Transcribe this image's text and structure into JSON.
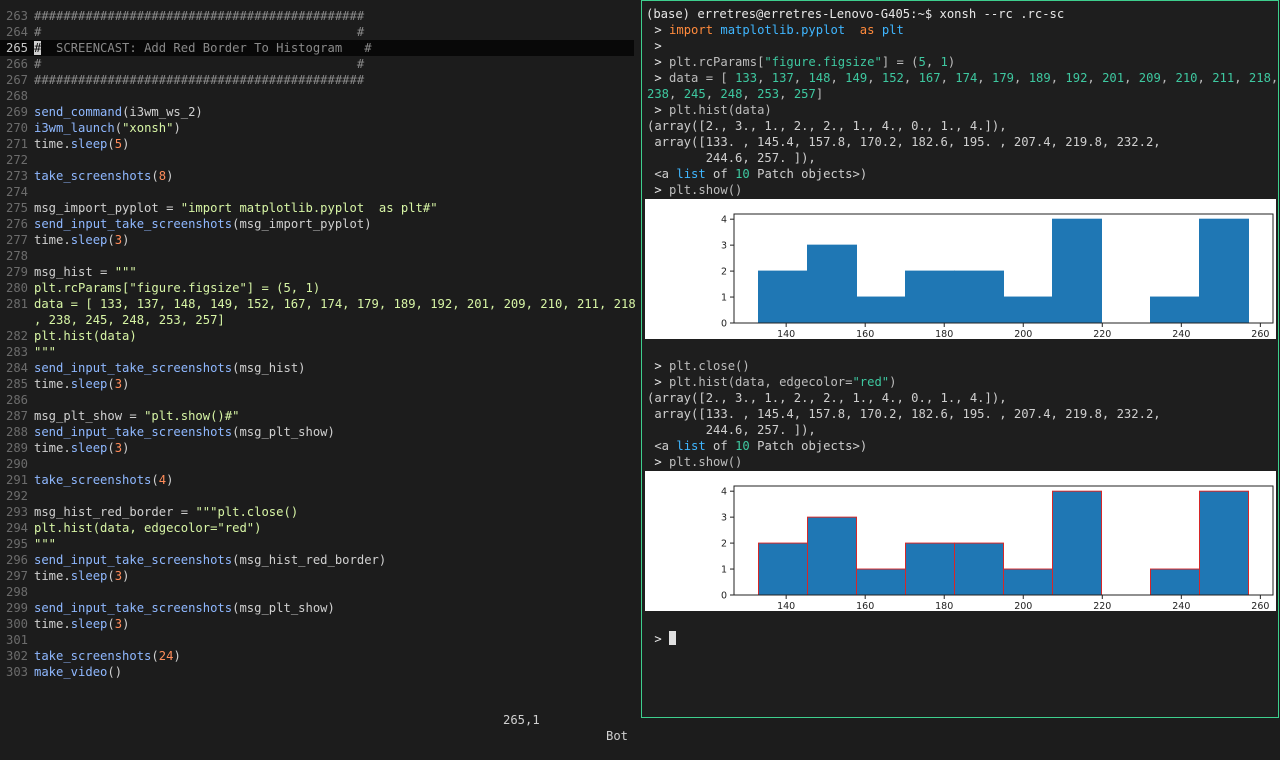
{
  "editor": {
    "lines": [
      {
        "n": "263",
        "t": [
          [
            "#############################################",
            "com"
          ]
        ]
      },
      {
        "n": "264",
        "t": [
          [
            "#                                           #",
            "com"
          ]
        ]
      },
      {
        "n": "265",
        "current": true,
        "t": [
          [
            "#",
            "cursor"
          ],
          [
            "  SCREENCAST: Add Red Border To Histogram   #",
            "com"
          ]
        ]
      },
      {
        "n": "266",
        "t": [
          [
            "#                                           #",
            "com"
          ]
        ]
      },
      {
        "n": "267",
        "t": [
          [
            "#############################################",
            "com"
          ]
        ]
      },
      {
        "n": "268",
        "t": []
      },
      {
        "n": "269",
        "t": [
          [
            "send_command",
            "fn"
          ],
          [
            "(i3wm_ws_2)",
            "id"
          ]
        ]
      },
      {
        "n": "270",
        "t": [
          [
            "i3wm_launch",
            "fn"
          ],
          [
            "(",
            "id"
          ],
          [
            "\"xonsh\"",
            "str"
          ],
          [
            ")",
            "id"
          ]
        ]
      },
      {
        "n": "271",
        "t": [
          [
            "time.",
            "id"
          ],
          [
            "sleep",
            "fn"
          ],
          [
            "(",
            "id"
          ],
          [
            "5",
            "num"
          ],
          [
            ")",
            "id"
          ]
        ]
      },
      {
        "n": "272",
        "t": []
      },
      {
        "n": "273",
        "t": [
          [
            "take_screenshots",
            "fn"
          ],
          [
            "(",
            "id"
          ],
          [
            "8",
            "num"
          ],
          [
            ")",
            "id"
          ]
        ]
      },
      {
        "n": "274",
        "t": []
      },
      {
        "n": "275",
        "t": [
          [
            "msg_import_pyplot = ",
            "id"
          ],
          [
            "\"import matplotlib.pyplot  as plt#\"",
            "str"
          ]
        ]
      },
      {
        "n": "276",
        "t": [
          [
            "send_input_take_screenshots",
            "fn"
          ],
          [
            "(msg_import_pyplot)",
            "id"
          ]
        ]
      },
      {
        "n": "277",
        "t": [
          [
            "time.",
            "id"
          ],
          [
            "sleep",
            "fn"
          ],
          [
            "(",
            "id"
          ],
          [
            "3",
            "num"
          ],
          [
            ")",
            "id"
          ]
        ]
      },
      {
        "n": "278",
        "t": []
      },
      {
        "n": "279",
        "t": [
          [
            "msg_hist = ",
            "id"
          ],
          [
            "\"\"\"",
            "str"
          ]
        ]
      },
      {
        "n": "280",
        "t": [
          [
            "plt.rcParams[\"figure.figsize\"] = (5, 1)",
            "str"
          ]
        ]
      },
      {
        "n": "281",
        "t": [
          [
            "data = [ 133, 137, 148, 149, 152, 167, 174, 179, 189, 192, 201, 209, 210, 211, 218",
            "str"
          ]
        ]
      },
      {
        "n": "",
        "t": [
          [
            ", 238, 245, 248, 253, 257]",
            "str"
          ]
        ]
      },
      {
        "n": "282",
        "t": [
          [
            "plt.hist(data)",
            "str"
          ]
        ]
      },
      {
        "n": "283",
        "t": [
          [
            "\"\"\"",
            "str"
          ]
        ]
      },
      {
        "n": "284",
        "t": [
          [
            "send_input_take_screenshots",
            "fn"
          ],
          [
            "(msg_hist)",
            "id"
          ]
        ]
      },
      {
        "n": "285",
        "t": [
          [
            "time.",
            "id"
          ],
          [
            "sleep",
            "fn"
          ],
          [
            "(",
            "id"
          ],
          [
            "3",
            "num"
          ],
          [
            ")",
            "id"
          ]
        ]
      },
      {
        "n": "286",
        "t": []
      },
      {
        "n": "287",
        "t": [
          [
            "msg_plt_show = ",
            "id"
          ],
          [
            "\"plt.show()#\"",
            "str"
          ]
        ]
      },
      {
        "n": "288",
        "t": [
          [
            "send_input_take_screenshots",
            "fn"
          ],
          [
            "(msg_plt_show)",
            "id"
          ]
        ]
      },
      {
        "n": "289",
        "t": [
          [
            "time.",
            "id"
          ],
          [
            "sleep",
            "fn"
          ],
          [
            "(",
            "id"
          ],
          [
            "3",
            "num"
          ],
          [
            ")",
            "id"
          ]
        ]
      },
      {
        "n": "290",
        "t": []
      },
      {
        "n": "291",
        "t": [
          [
            "take_screenshots",
            "fn"
          ],
          [
            "(",
            "id"
          ],
          [
            "4",
            "num"
          ],
          [
            ")",
            "id"
          ]
        ]
      },
      {
        "n": "292",
        "t": []
      },
      {
        "n": "293",
        "t": [
          [
            "msg_hist_red_border = ",
            "id"
          ],
          [
            "\"\"\"plt.close()",
            "str"
          ]
        ]
      },
      {
        "n": "294",
        "t": [
          [
            "plt.hist(data, edgecolor=\"red\")",
            "str"
          ]
        ]
      },
      {
        "n": "295",
        "t": [
          [
            "\"\"\"",
            "str"
          ]
        ]
      },
      {
        "n": "296",
        "t": [
          [
            "send_input_take_screenshots",
            "fn"
          ],
          [
            "(msg_hist_red_border)",
            "id"
          ]
        ]
      },
      {
        "n": "297",
        "t": [
          [
            "time.",
            "id"
          ],
          [
            "sleep",
            "fn"
          ],
          [
            "(",
            "id"
          ],
          [
            "3",
            "num"
          ],
          [
            ")",
            "id"
          ]
        ]
      },
      {
        "n": "298",
        "t": []
      },
      {
        "n": "299",
        "t": [
          [
            "send_input_take_screenshots",
            "fn"
          ],
          [
            "(msg_plt_show)",
            "id"
          ]
        ]
      },
      {
        "n": "300",
        "t": [
          [
            "time.",
            "id"
          ],
          [
            "sleep",
            "fn"
          ],
          [
            "(",
            "id"
          ],
          [
            "3",
            "num"
          ],
          [
            ")",
            "id"
          ]
        ]
      },
      {
        "n": "301",
        "t": []
      },
      {
        "n": "302",
        "t": [
          [
            "take_screenshots",
            "fn"
          ],
          [
            "(",
            "id"
          ],
          [
            "24",
            "num"
          ],
          [
            ")",
            "id"
          ]
        ]
      },
      {
        "n": "303",
        "t": [
          [
            "make_video",
            "fn"
          ],
          [
            "()",
            "id"
          ]
        ]
      }
    ],
    "status_position": "265,1",
    "status_scroll": "Bot"
  },
  "terminal": {
    "header": "(base) erretres@erretres-Lenovo-G405:~$ xonsh --rc .rc-sc",
    "block1": [
      [
        [
          " > ",
          "prompt"
        ],
        [
          "import",
          "kw"
        ],
        [
          " matplotlib.pyplot",
          "mod"
        ],
        [
          "  as ",
          "kw"
        ],
        [
          "plt",
          "mod"
        ]
      ],
      [
        [
          " >",
          "prompt"
        ]
      ],
      [
        [
          " > ",
          "prompt"
        ],
        [
          "plt.rcParams[",
          "gray"
        ],
        [
          "\"figure.figsize\"",
          "str"
        ],
        [
          "] = (",
          "gray"
        ],
        [
          "5",
          "num"
        ],
        [
          ", ",
          "gray"
        ],
        [
          "1",
          "num"
        ],
        [
          ")",
          "gray"
        ]
      ],
      [
        [
          " > ",
          "prompt"
        ],
        [
          "data = [ ",
          "gray"
        ],
        [
          "133",
          "num"
        ],
        [
          ", ",
          "gray"
        ],
        [
          "137",
          "num"
        ],
        [
          ", ",
          "gray"
        ],
        [
          "148",
          "num"
        ],
        [
          ", ",
          "gray"
        ],
        [
          "149",
          "num"
        ],
        [
          ", ",
          "gray"
        ],
        [
          "152",
          "num"
        ],
        [
          ", ",
          "gray"
        ],
        [
          "167",
          "num"
        ],
        [
          ", ",
          "gray"
        ],
        [
          "174",
          "num"
        ],
        [
          ", ",
          "gray"
        ],
        [
          "179",
          "num"
        ],
        [
          ", ",
          "gray"
        ],
        [
          "189",
          "num"
        ],
        [
          ", ",
          "gray"
        ],
        [
          "192",
          "num"
        ],
        [
          ", ",
          "gray"
        ],
        [
          "201",
          "num"
        ],
        [
          ", ",
          "gray"
        ],
        [
          "209",
          "num"
        ],
        [
          ", ",
          "gray"
        ],
        [
          "210",
          "num"
        ],
        [
          ", ",
          "gray"
        ],
        [
          "211",
          "num"
        ],
        [
          ", ",
          "gray"
        ],
        [
          "218",
          "num"
        ],
        [
          ",",
          "gray"
        ]
      ],
      [
        [
          "238",
          "num"
        ],
        [
          ", ",
          "gray"
        ],
        [
          "245",
          "num"
        ],
        [
          ", ",
          "gray"
        ],
        [
          "248",
          "num"
        ],
        [
          ", ",
          "gray"
        ],
        [
          "253",
          "num"
        ],
        [
          ", ",
          "gray"
        ],
        [
          "257",
          "num"
        ],
        [
          "]",
          "gray"
        ]
      ],
      [
        [
          " > ",
          "prompt"
        ],
        [
          "plt.hist(data)",
          "gray"
        ]
      ],
      [
        [
          "(array([2., 3., 1., 2., 2., 1., 4., 0., 1., 4.]),",
          "dim"
        ]
      ],
      [
        [
          " array([133. , 145.4, 157.8, 170.2, 182.6, 195. , 207.4, 219.8, 232.2,",
          "dim"
        ]
      ],
      [
        [
          "        244.6, 257. ]),",
          "dim"
        ]
      ],
      [
        [
          " <a ",
          "dim"
        ],
        [
          "list",
          "mod"
        ],
        [
          " of ",
          "dim"
        ],
        [
          "10",
          "num"
        ],
        [
          " Patch objects>)",
          "dim"
        ]
      ],
      [
        [
          " > ",
          "prompt"
        ],
        [
          "plt.show()",
          "gray"
        ]
      ]
    ],
    "block2": [
      [
        [
          " > ",
          "prompt"
        ],
        [
          "plt.close()",
          "gray"
        ]
      ],
      [
        [
          " > ",
          "prompt"
        ],
        [
          "plt.hist(data, edgecolor=",
          "gray"
        ],
        [
          "\"red\"",
          "str"
        ],
        [
          ")",
          "gray"
        ]
      ],
      [
        [
          "(array([2., 3., 1., 2., 2., 1., 4., 0., 1., 4.]),",
          "dim"
        ]
      ],
      [
        [
          " array([133. , 145.4, 157.8, 170.2, 182.6, 195. , 207.4, 219.8, 232.2,",
          "dim"
        ]
      ],
      [
        [
          "        244.6, 257. ]),",
          "dim"
        ]
      ],
      [
        [
          " <a ",
          "dim"
        ],
        [
          "list",
          "mod"
        ],
        [
          " of ",
          "dim"
        ],
        [
          "10",
          "num"
        ],
        [
          " Patch objects>)",
          "dim"
        ]
      ],
      [
        [
          " > ",
          "prompt"
        ],
        [
          "plt.show()",
          "gray"
        ]
      ]
    ],
    "final_prompt": " > "
  },
  "chart_data": [
    {
      "type": "bar",
      "bins": [
        133,
        145.4,
        157.8,
        170.2,
        182.6,
        195,
        207.4,
        219.8,
        232.2,
        244.6,
        257
      ],
      "values": [
        2,
        3,
        1,
        2,
        2,
        1,
        4,
        0,
        1,
        4
      ],
      "xticks": [
        140,
        160,
        180,
        200,
        220,
        240,
        260
      ],
      "yticks": [
        0,
        1,
        2,
        3,
        4
      ],
      "xlim": [
        126.8,
        263.2
      ],
      "ylim": [
        0,
        4.2
      ],
      "fill": "#1f77b4",
      "edge": "#1f77b4"
    },
    {
      "type": "bar",
      "bins": [
        133,
        145.4,
        157.8,
        170.2,
        182.6,
        195,
        207.4,
        219.8,
        232.2,
        244.6,
        257
      ],
      "values": [
        2,
        3,
        1,
        2,
        2,
        1,
        4,
        0,
        1,
        4
      ],
      "xticks": [
        140,
        160,
        180,
        200,
        220,
        240,
        260
      ],
      "yticks": [
        0,
        1,
        2,
        3,
        4
      ],
      "xlim": [
        126.8,
        263.2
      ],
      "ylim": [
        0,
        4.2
      ],
      "fill": "#1f77b4",
      "edge": "#d62728"
    }
  ]
}
